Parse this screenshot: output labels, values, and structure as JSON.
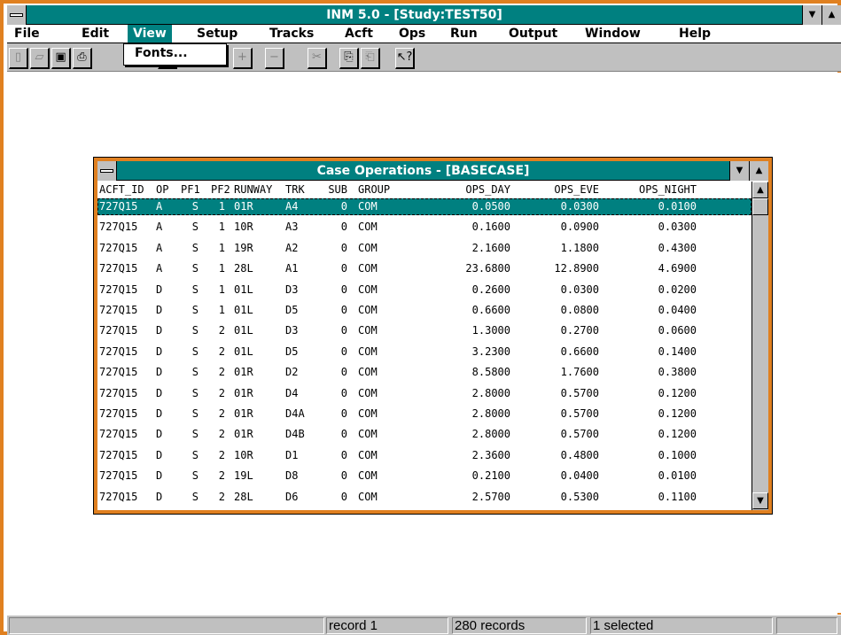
{
  "app": {
    "title": "INM 5.0 - [Study:TEST50]"
  },
  "menu": {
    "items": [
      "File",
      "Edit",
      "View",
      "Setup",
      "Tracks",
      "Acft",
      "Ops",
      "Run",
      "Output",
      "Window",
      "Help"
    ],
    "active": "View",
    "dropdown_item": "Fonts..."
  },
  "toolbar": {
    "buttons": [
      "new-icon",
      "open-icon",
      "save-icon",
      "print-icon",
      "add-icon",
      "remove-icon",
      "cut-icon",
      "copy-icon",
      "paste-icon",
      "help-icon"
    ]
  },
  "child_window": {
    "title": "Case Operations - [BASECASE]",
    "columns": [
      "ACFT_ID",
      "OP",
      "PF1",
      "PF2",
      "RUNWAY",
      "TRK",
      "SUB",
      "GROUP",
      "OPS_DAY",
      "OPS_EVE",
      "OPS_NIGHT"
    ],
    "rows": [
      [
        "727Q15",
        "A",
        "S",
        "1",
        "01R",
        "A4",
        "0",
        "COM",
        "0.0500",
        "0.0300",
        "0.0100"
      ],
      [
        "727Q15",
        "A",
        "S",
        "1",
        "10R",
        "A3",
        "0",
        "COM",
        "0.1600",
        "0.0900",
        "0.0300"
      ],
      [
        "727Q15",
        "A",
        "S",
        "1",
        "19R",
        "A2",
        "0",
        "COM",
        "2.1600",
        "1.1800",
        "0.4300"
      ],
      [
        "727Q15",
        "A",
        "S",
        "1",
        "28L",
        "A1",
        "0",
        "COM",
        "23.6800",
        "12.8900",
        "4.6900"
      ],
      [
        "727Q15",
        "D",
        "S",
        "1",
        "01L",
        "D3",
        "0",
        "COM",
        "0.2600",
        "0.0300",
        "0.0200"
      ],
      [
        "727Q15",
        "D",
        "S",
        "1",
        "01L",
        "D5",
        "0",
        "COM",
        "0.6600",
        "0.0800",
        "0.0400"
      ],
      [
        "727Q15",
        "D",
        "S",
        "2",
        "01L",
        "D3",
        "0",
        "COM",
        "1.3000",
        "0.2700",
        "0.0600"
      ],
      [
        "727Q15",
        "D",
        "S",
        "2",
        "01L",
        "D5",
        "0",
        "COM",
        "3.2300",
        "0.6600",
        "0.1400"
      ],
      [
        "727Q15",
        "D",
        "S",
        "2",
        "01R",
        "D2",
        "0",
        "COM",
        "8.5800",
        "1.7600",
        "0.3800"
      ],
      [
        "727Q15",
        "D",
        "S",
        "2",
        "01R",
        "D4",
        "0",
        "COM",
        "2.8000",
        "0.5700",
        "0.1200"
      ],
      [
        "727Q15",
        "D",
        "S",
        "2",
        "01R",
        "D4A",
        "0",
        "COM",
        "2.8000",
        "0.5700",
        "0.1200"
      ],
      [
        "727Q15",
        "D",
        "S",
        "2",
        "01R",
        "D4B",
        "0",
        "COM",
        "2.8000",
        "0.5700",
        "0.1200"
      ],
      [
        "727Q15",
        "D",
        "S",
        "2",
        "10R",
        "D1",
        "0",
        "COM",
        "2.3600",
        "0.4800",
        "0.1000"
      ],
      [
        "727Q15",
        "D",
        "S",
        "2",
        "19L",
        "D8",
        "0",
        "COM",
        "0.2100",
        "0.0400",
        "0.0100"
      ],
      [
        "727Q15",
        "D",
        "S",
        "2",
        "28L",
        "D6",
        "0",
        "COM",
        "2.5700",
        "0.5300",
        "0.1100"
      ]
    ],
    "selected_row": 0
  },
  "status": {
    "record": "record 1",
    "count": "280 records",
    "selected": "1 selected"
  },
  "colors": {
    "titlebar": "#008080",
    "frame": "#e08020",
    "chrome": "#c0c0c0"
  }
}
